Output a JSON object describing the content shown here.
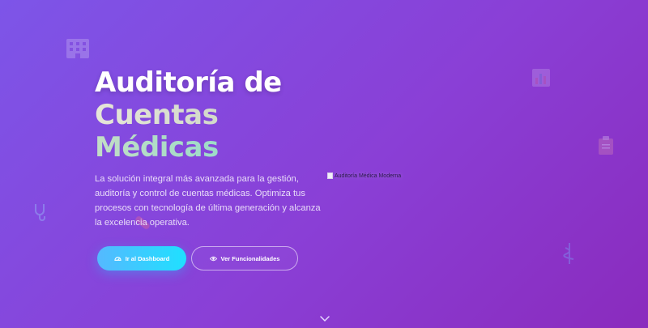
{
  "hero": {
    "title_line1": "Auditoría de",
    "title_line2": "Cuentas",
    "title_line3": "Médicas",
    "description": "La solución integral más avanzada para la gestión, auditoría y control de cuentas médicas. Optimiza tus procesos con tecnología de última generación y alcanza la excelencia operativa."
  },
  "buttons": {
    "dashboard_label": "Ir al Dashboard",
    "features_label": "Ver Funcionalidades"
  },
  "image": {
    "alt": "Auditoría Médica Moderna"
  },
  "icons": {
    "dashboard": "gauge-icon",
    "features": "eye-icon",
    "scroll": "chevron-down-icon",
    "decor": [
      "hospital-icon",
      "chart-icon",
      "clipboard-icon",
      "pill-icon",
      "stethoscope-icon",
      "caduceus-icon"
    ]
  },
  "colors": {
    "bg_start": "#7d55e8",
    "bg_end": "#8a2bbd",
    "primary_button": "#1fe0ff",
    "title_accent": "#7fd8c4"
  }
}
